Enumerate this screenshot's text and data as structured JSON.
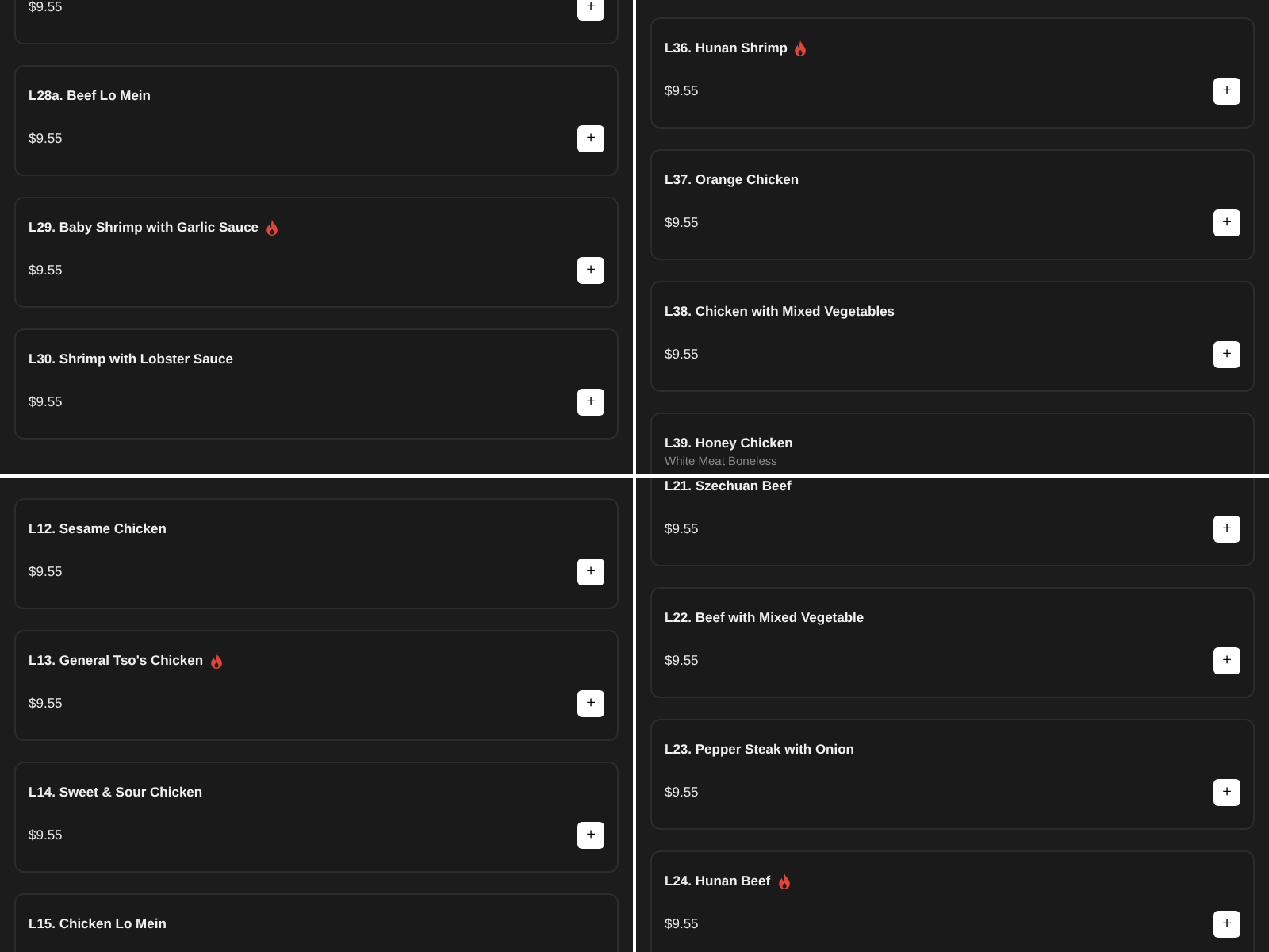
{
  "panels": [
    {
      "items": [
        {
          "price": "$9.55",
          "add_button": "+"
        },
        {
          "title": "L28a. Beef Lo Mein",
          "price": "$9.55",
          "add_button": "+",
          "spicy": false
        },
        {
          "title": "L29. Baby Shrimp with Garlic Sauce",
          "price": "$9.55",
          "add_button": "+",
          "spicy": true
        },
        {
          "title": "L30. Shrimp with Lobster Sauce",
          "price": "$9.55",
          "add_button": "+",
          "spicy": false
        }
      ]
    },
    {
      "items": [
        {
          "title": "L36. Hunan Shrimp",
          "price": "$9.55",
          "add_button": "+",
          "spicy": true
        },
        {
          "title": "L37. Orange Chicken",
          "price": "$9.55",
          "add_button": "+",
          "spicy": false
        },
        {
          "title": "L38. Chicken with Mixed Vegetables",
          "price": "$9.55",
          "add_button": "+",
          "spicy": false
        },
        {
          "title": "L39. Honey Chicken",
          "subtitle": "White Meat Boneless",
          "spicy": false
        }
      ]
    },
    {
      "items": [
        {
          "title": "L12. Sesame Chicken",
          "price": "$9.55",
          "add_button": "+",
          "spicy": false
        },
        {
          "title": "L13. General Tso's Chicken",
          "price": "$9.55",
          "add_button": "+",
          "spicy": true
        },
        {
          "title": "L14. Sweet & Sour Chicken",
          "price": "$9.55",
          "add_button": "+",
          "spicy": false
        },
        {
          "title": "L15. Chicken Lo Mein",
          "spicy": false
        }
      ]
    },
    {
      "items": [
        {
          "title": "L21. Szechuan Beef",
          "price": "$9.55",
          "add_button": "+",
          "spicy": false
        },
        {
          "title": "L22. Beef with Mixed Vegetable",
          "price": "$9.55",
          "add_button": "+",
          "spicy": false
        },
        {
          "title": "L23. Pepper Steak with Onion",
          "price": "$9.55",
          "add_button": "+",
          "spicy": false
        },
        {
          "title": "L24. Hunan Beef",
          "price": "$9.55",
          "add_button": "+",
          "spicy": true
        }
      ]
    }
  ]
}
